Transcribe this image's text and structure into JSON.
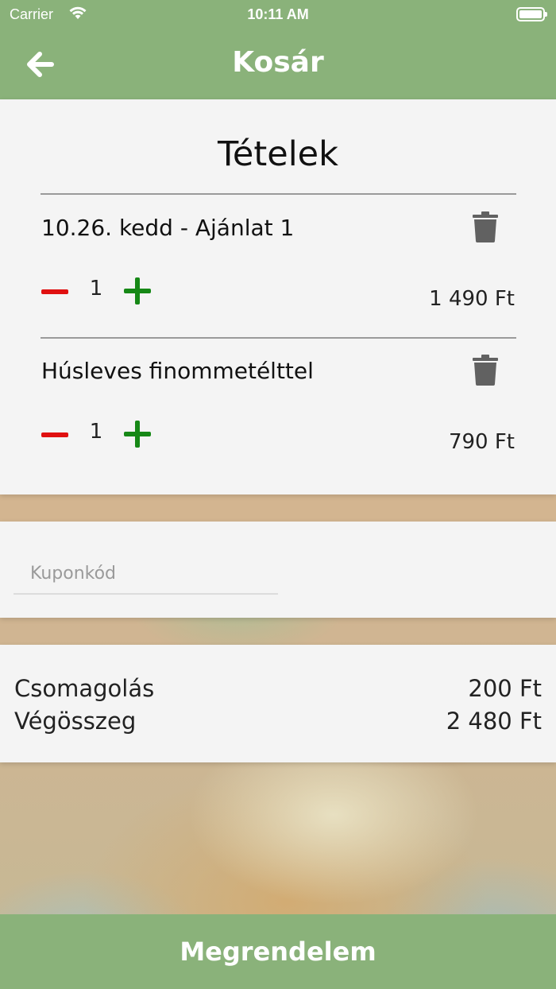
{
  "status_bar": {
    "carrier": "Carrier",
    "time": "10:11 AM"
  },
  "navbar": {
    "title": "Kosár",
    "back_icon": "arrow-left-icon"
  },
  "items_section": {
    "title": "Tételek",
    "items": [
      {
        "name": "10.26. kedd - Ajánlat 1",
        "quantity": "1",
        "price": "1 490 Ft"
      },
      {
        "name": "Húsleves finommetélttel",
        "quantity": "1",
        "price": "790 Ft"
      }
    ]
  },
  "coupon": {
    "placeholder": "Kuponkód",
    "value": ""
  },
  "totals": {
    "packaging_label": "Csomagolás",
    "packaging_value": "200 Ft",
    "total_label": "Végösszeg",
    "total_value": "2 480 Ft"
  },
  "order_button": {
    "label": "Megrendelem"
  },
  "colors": {
    "accent": "#8ab27a",
    "minus": "#e01010",
    "plus": "#168816",
    "card": "#f4f4f4"
  }
}
